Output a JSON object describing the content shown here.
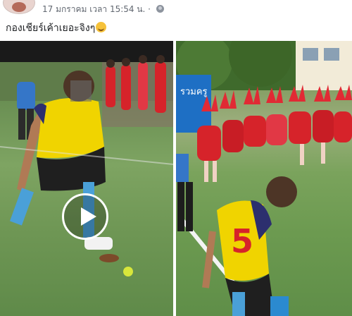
{
  "post": {
    "timestamp": "17 มกราคม เวลา 15:54 น.",
    "dot": " · ",
    "text": "กองเชียร์เค้าเยอะจิงๆ",
    "privacy_icon": "globe-icon",
    "emoji": "grinning-face-icon"
  },
  "media": {
    "left": {
      "kind": "video",
      "play_icon": "play-icon"
    },
    "right": {
      "kind": "photo",
      "jersey_number": "5",
      "banner_text": "รวมครู"
    }
  },
  "colors": {
    "meta_text": "#616770",
    "post_text": "#1c1e21",
    "jersey_yellow": "#f0d400",
    "cheer_red": "#d6232a"
  }
}
